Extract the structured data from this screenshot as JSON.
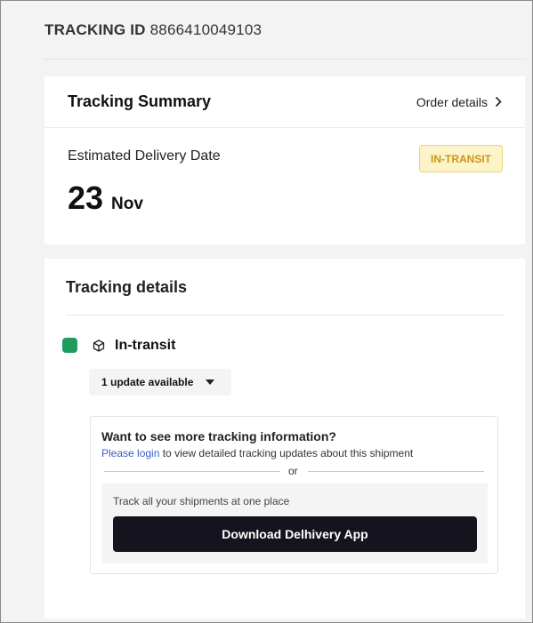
{
  "header": {
    "label": "TRACKING ID",
    "tracking_id": "8866410049103"
  },
  "summary": {
    "title": "Tracking Summary",
    "order_details_label": "Order details",
    "order_details_icon": "chevron-right-icon",
    "edd_label": "Estimated Delivery Date",
    "edd_day": "23",
    "edd_month": "Nov",
    "status_badge": "IN-TRANSIT",
    "colors": {
      "badge_bg": "#fdf3c9",
      "badge_text": "#c9971a"
    }
  },
  "details": {
    "title": "Tracking details",
    "status": "In-transit",
    "status_icon": "package-icon",
    "status_color": "#1f9c5c",
    "updates_label": "1 update available",
    "updates_icon": "caret-down-icon",
    "login_prompt": {
      "question": "Want to see more tracking information?",
      "link_text": "Please login",
      "rest_text": " to view detailed tracking updates about this shipment",
      "or_text": "or",
      "app_text": "Track all your shipments at one place",
      "app_button": "Download Delhivery App"
    }
  }
}
